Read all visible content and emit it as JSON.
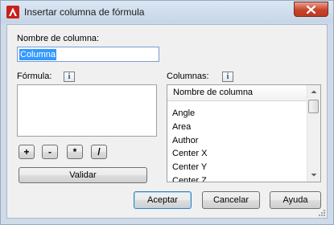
{
  "window": {
    "title": "Insertar columna de fórmula",
    "accent_color": "#c0391f"
  },
  "icons": {
    "app": "autocad-a-icon",
    "close": "close-icon",
    "info": "info-icon"
  },
  "column_name": {
    "label": "Nombre de columna:",
    "value": "Columna"
  },
  "formula": {
    "label": "Fórmula:",
    "value": "",
    "operators": [
      "+",
      "-",
      "*",
      "/"
    ],
    "validate_label": "Validar"
  },
  "columns": {
    "label": "Columnas:",
    "header": "Nombre de columna",
    "items": [
      "Angle",
      "Area",
      "Author",
      "Center X",
      "Center Y",
      "Center Z"
    ]
  },
  "footer": {
    "ok_label": "Aceptar",
    "cancel_label": "Cancelar",
    "help_label": "Ayuda"
  }
}
